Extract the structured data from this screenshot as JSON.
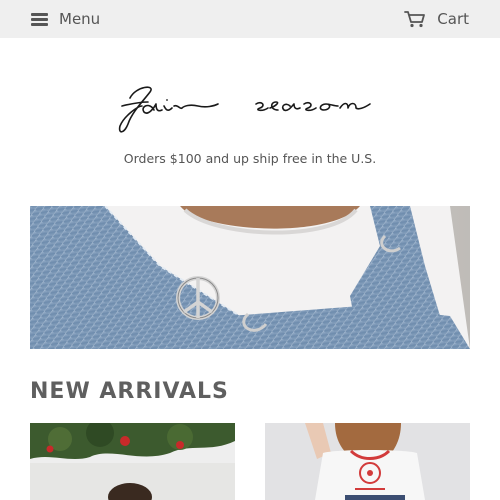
{
  "header": {
    "menu_label": "Menu",
    "menu_icon": "hamburger-icon",
    "cart_label": "Cart",
    "cart_icon": "cart-icon"
  },
  "brand": {
    "logo_text": "fair season"
  },
  "promo": {
    "text": "Orders $100 and up ship free in the U.S."
  },
  "hero": {
    "icon": "peace-sign-pin"
  },
  "sections": {
    "new_arrivals_title": "NEW ARRIVALS"
  },
  "colors": {
    "topbar_bg": "#efefef",
    "text_muted": "#555555",
    "heading": "#5f5f5f"
  }
}
